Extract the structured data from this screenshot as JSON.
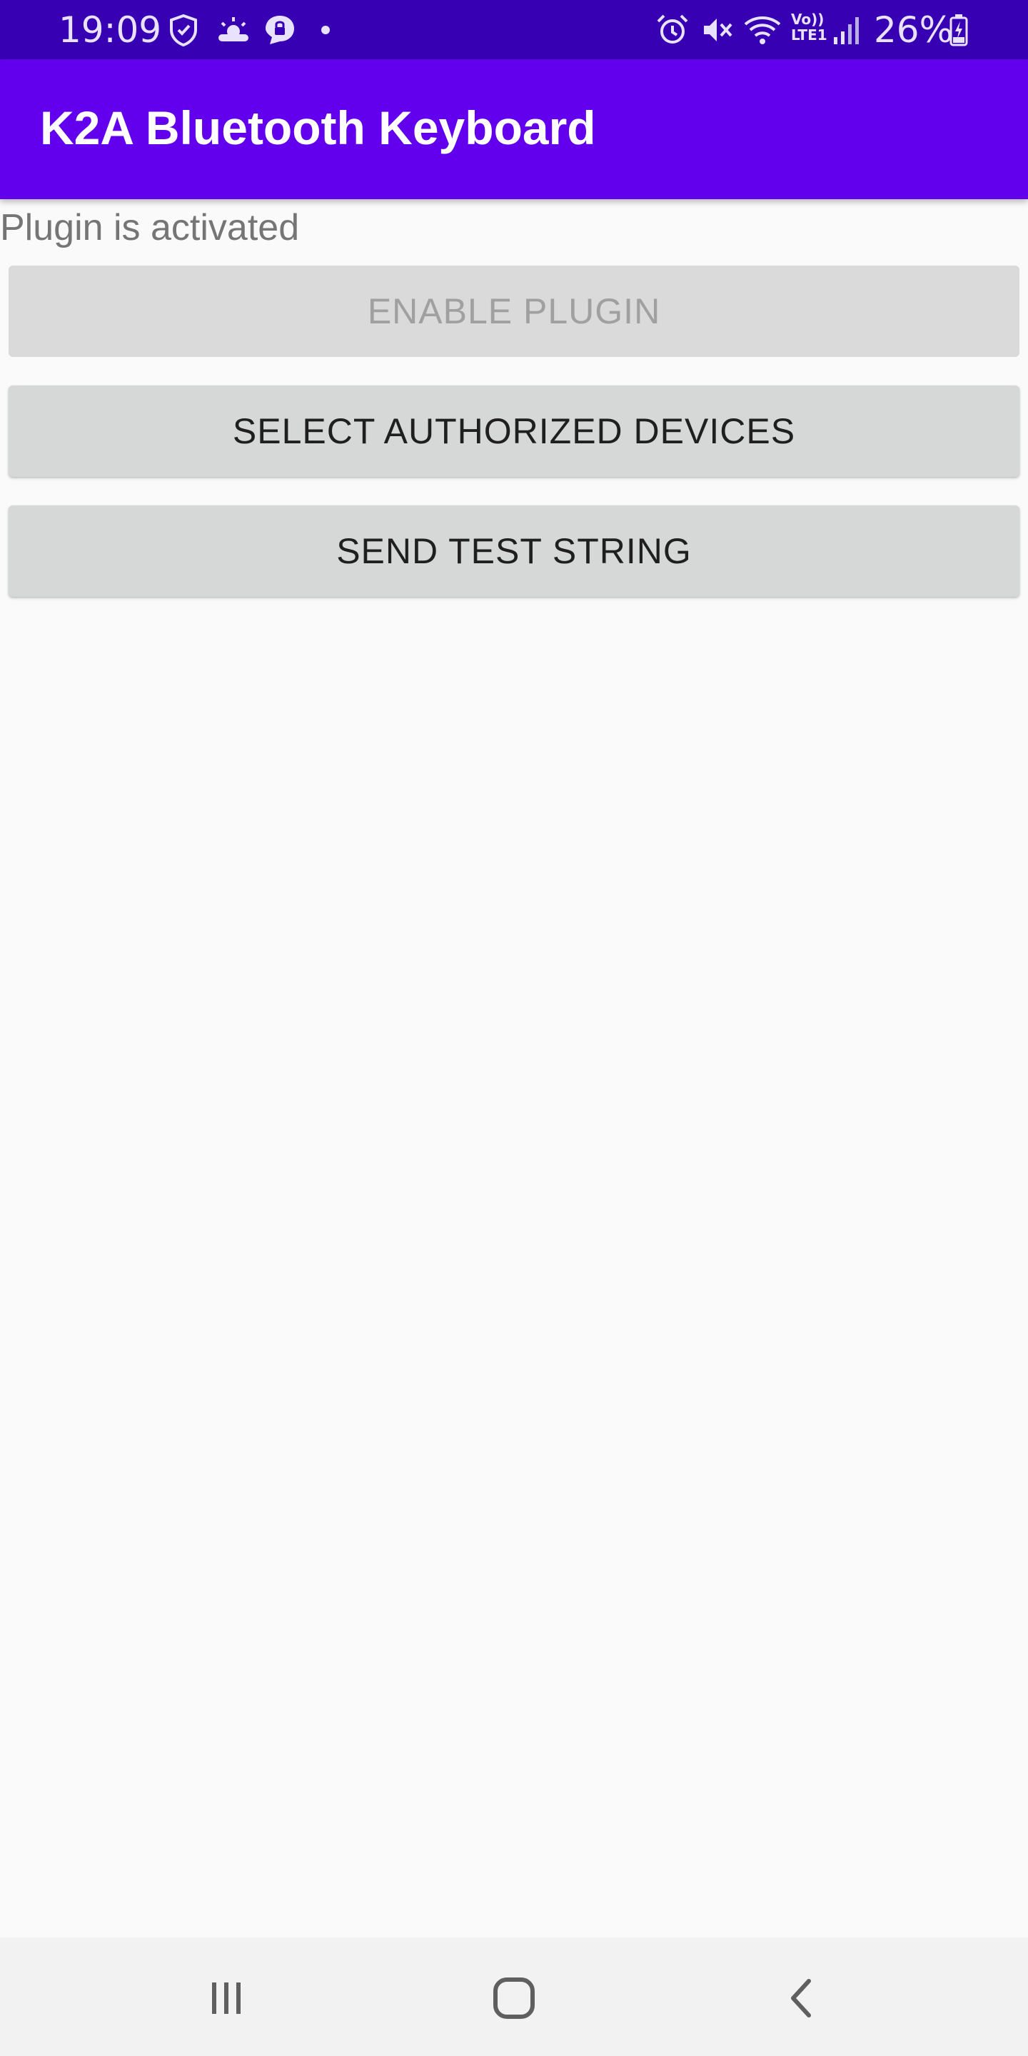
{
  "status_bar": {
    "time": "19:09",
    "battery": "26%",
    "icons_left": [
      "shield-icon",
      "weather-icon",
      "vpn-lock-icon",
      "notification-dot-icon"
    ],
    "icons_right": [
      "alarm-icon",
      "mute-icon",
      "wifi-icon",
      "volte-icon",
      "signal-icon",
      "battery-icon"
    ],
    "volte_label_top": "Vo))",
    "volte_label_bottom": "LTE1"
  },
  "app_bar": {
    "title": "K2A Bluetooth Keyboard",
    "color": "#6200EE"
  },
  "main": {
    "status_text": "Plugin is activated",
    "buttons": {
      "enable_plugin": "ENABLE PLUGIN",
      "select_devices": "SELECT AUTHORIZED DEVICES",
      "send_test": "SEND TEST STRING"
    }
  },
  "nav_bar": {
    "icons": [
      "recents-icon",
      "home-icon",
      "back-icon"
    ]
  },
  "colors": {
    "status_bar": "#3700B3",
    "app_bar": "#6200EE",
    "background": "#FAFAFA",
    "button": "#D6D7D7"
  }
}
